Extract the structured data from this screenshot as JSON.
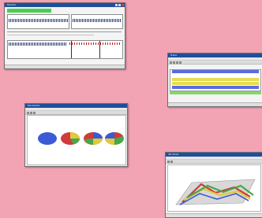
{
  "windows": {
    "monitor": {
      "title": "Monitor",
      "status": ""
    },
    "trace": {
      "title": "Trace"
    },
    "piechart": {
      "title": "Pie Charts"
    },
    "chart3d": {
      "title": "3D Chart"
    }
  },
  "colors": {
    "desktop": "#f2a4b5",
    "accent_green": "#46d14f",
    "pie_blue": "#3b5bd6",
    "pie_red": "#d23b3b",
    "pie_yellow": "#e2c83b",
    "pie_green": "#45a84a",
    "row_blue": "#5a6ce0",
    "row_yellow": "#e6dc54",
    "row_green": "#88d66b"
  }
}
